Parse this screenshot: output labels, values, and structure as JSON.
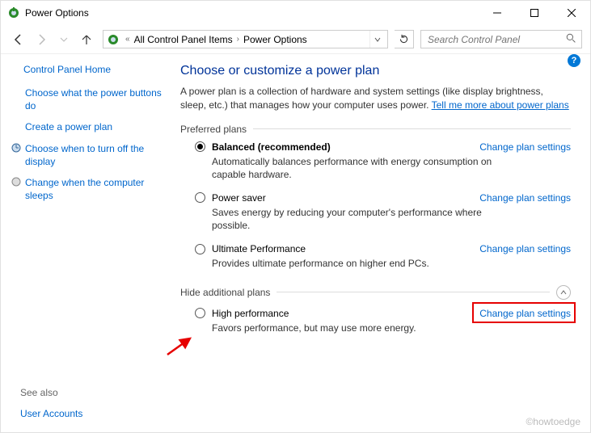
{
  "titlebar": {
    "title": "Power Options"
  },
  "breadcrumb": {
    "item1": "All Control Panel Items",
    "item2": "Power Options"
  },
  "search": {
    "placeholder": "Search Control Panel"
  },
  "sidebar": {
    "home": "Control Panel Home",
    "items": [
      {
        "label": "Choose what the power buttons do"
      },
      {
        "label": "Create a power plan"
      },
      {
        "label": "Choose when to turn off the display"
      },
      {
        "label": "Change when the computer sleeps"
      }
    ]
  },
  "main": {
    "heading": "Choose or customize a power plan",
    "intro_pre": "A power plan is a collection of hardware and system settings (like display brightness, sleep, etc.) that manages how your computer uses power. ",
    "intro_link": "Tell me more about power plans",
    "preferred_label": "Preferred plans",
    "change_link": "Change plan settings",
    "plans": [
      {
        "name": "Balanced (recommended)",
        "desc": "Automatically balances performance with energy consumption on capable hardware.",
        "selected": true
      },
      {
        "name": "Power saver",
        "desc": "Saves energy by reducing your computer's performance where possible.",
        "selected": false
      },
      {
        "name": "Ultimate Performance",
        "desc": "Provides ultimate performance on higher end PCs.",
        "selected": false
      }
    ],
    "hide_label": "Hide additional plans",
    "extra_plan": {
      "name": "High performance",
      "desc": "Favors performance, but may use more energy.",
      "selected": false
    }
  },
  "footer": {
    "see_also": "See also",
    "user_accounts": "User Accounts"
  },
  "watermark": "©howtoedge"
}
